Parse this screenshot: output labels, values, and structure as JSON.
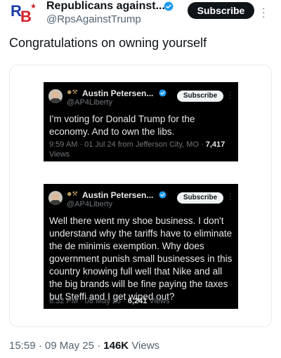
{
  "author": {
    "name": "Republicans against...",
    "handle": "@RpsAgainstTrump",
    "avatar_letters": [
      "R",
      "B"
    ],
    "subscribe_label": "Subscribe",
    "verified_color": "#1d9bf0"
  },
  "tweet": {
    "text": "Congratulations on owning yourself",
    "time": "15:59",
    "date": "09 May 25",
    "views_count": "146K",
    "views_label": "Views"
  },
  "embedded": [
    {
      "name": "Austin Petersen...",
      "handle": "@AP4Liberty",
      "subscribe_label": "Subscribe",
      "body": "I'm voting for Donald Trump for the economy. And to own the libs.",
      "meta_prefix": "9:59 AM · 01 Jul 24 from Jefferson City, MO · ",
      "views_count": "7,417",
      "views_label": "Views"
    },
    {
      "name": "Austin Petersen...",
      "handle": "@AP4Liberty",
      "subscribe_label": "Subscribe",
      "body": "Well there went my shoe business. I don't understand why the tariffs have to eliminate the de minimis exemption. Why does government punish small businesses in this country knowing full well that Nike and all the big brands will be fine paying the taxes but Steffi and I get wiped out?",
      "meta_prefix": "6:32 PM · 08 May 25 · ",
      "views_count": "6,241",
      "views_label": "Views"
    }
  ],
  "colors": {
    "accent": "#1d9bf0",
    "text": "#0f1419",
    "muted": "#536471",
    "dark_bg": "#000000"
  }
}
